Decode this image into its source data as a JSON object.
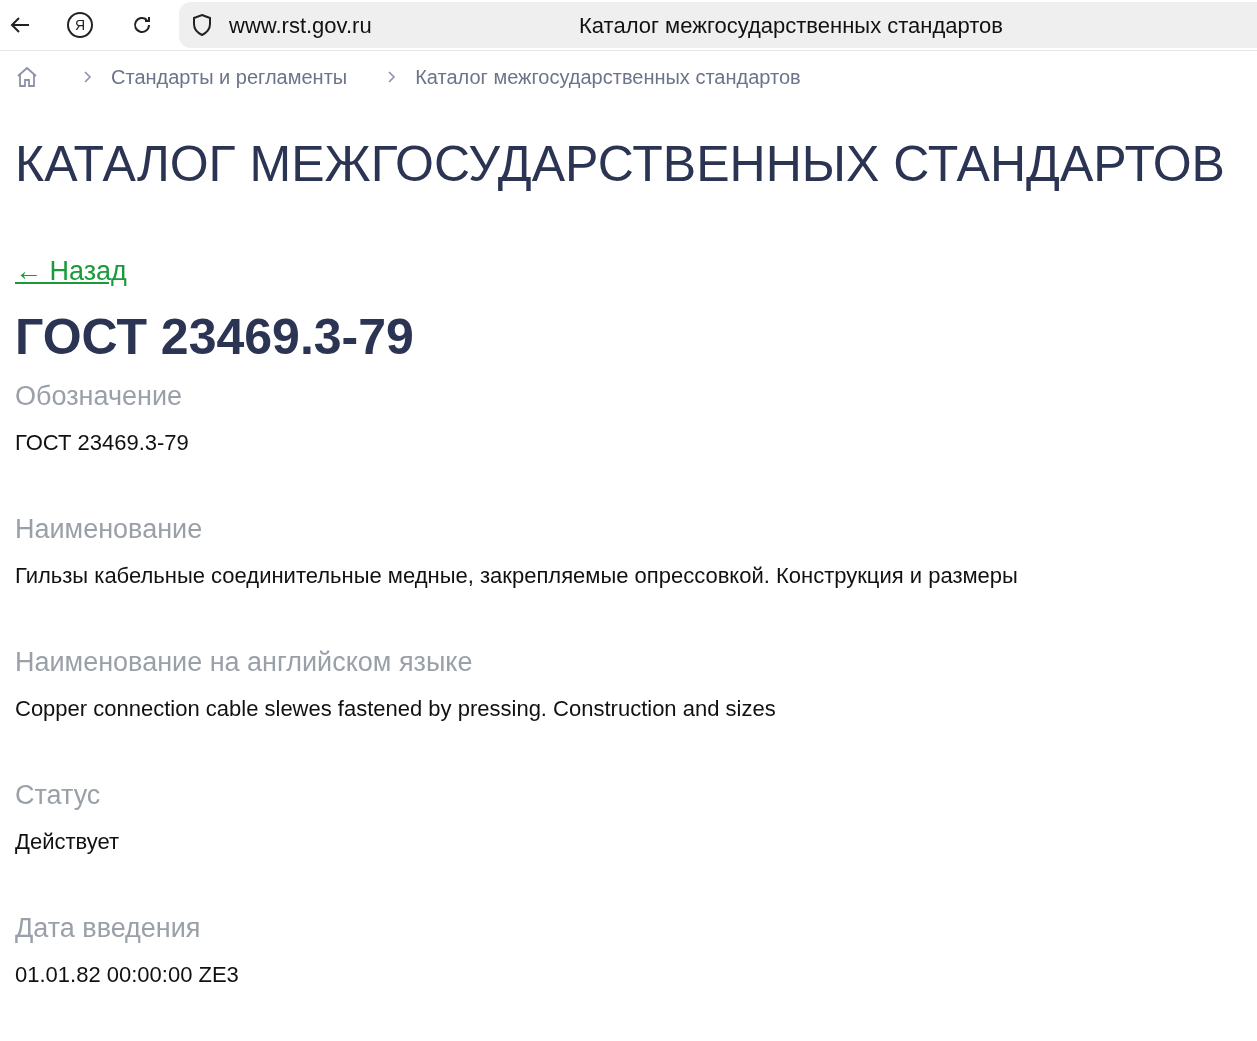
{
  "browser": {
    "yandex_glyph": "Я",
    "url": "www.rst.gov.ru",
    "page_title": "Каталог межгосударственных стандартов"
  },
  "breadcrumbs": [
    {
      "label": "Стандарты и регламенты"
    },
    {
      "label": "Каталог межгосударственных стандартов"
    }
  ],
  "page_title": "КАТАЛОГ МЕЖГОСУДАРСТВЕННЫХ СТАНДАРТОВ",
  "back_link": "← Назад",
  "standard_title": "ГОСТ 23469.3-79",
  "fields": [
    {
      "label": "Обозначение",
      "value": "ГОСТ 23469.3-79"
    },
    {
      "label": "Наименование",
      "value": "Гильзы кабельные соединительные медные, закрепляемые опрессовкой. Конструкция и размеры"
    },
    {
      "label": "Наименование на английском языке",
      "value": "Copper connection cable slewes fastened by pressing. Construction and sizes"
    },
    {
      "label": "Статус",
      "value": "Действует"
    },
    {
      "label": "Дата введения",
      "value": "01.01.82 00:00:00 ZE3"
    }
  ]
}
